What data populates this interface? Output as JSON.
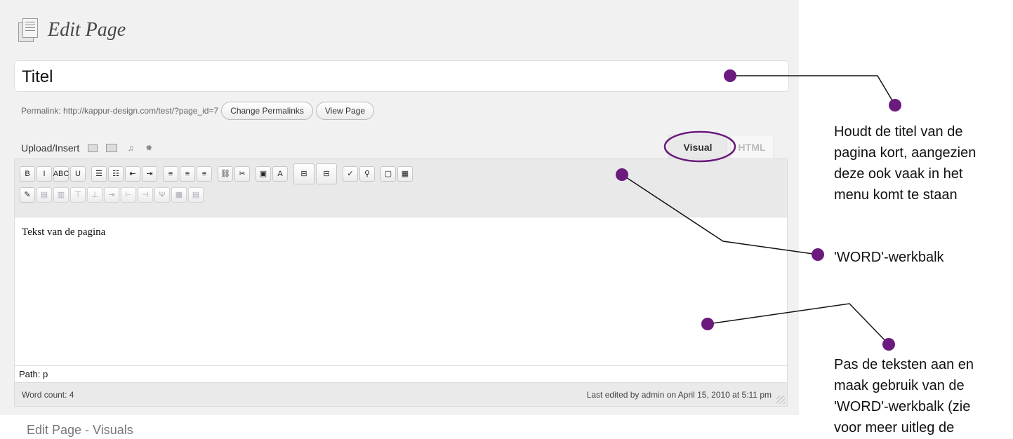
{
  "heading": {
    "title": "Edit Page",
    "icon": "page-icon"
  },
  "title_field": {
    "value": "Titel"
  },
  "permalink": {
    "label": "Permalink: http://kappur-design.com/test/?page_id=7",
    "change_button": "Change Permalinks",
    "view_button": "View Page"
  },
  "upload": {
    "label": "Upload/Insert",
    "icons": [
      "image-icon",
      "video-icon",
      "audio-icon",
      "media-icon"
    ]
  },
  "tabs": {
    "visual": "Visual",
    "html": "HTML"
  },
  "editor": {
    "content": "Tekst van de pagina",
    "path": "Path: p",
    "word_count": "Word count: 4",
    "last_edited": "Last edited by admin on April 15, 2010 at 5:11 pm"
  },
  "toolbar_row1": [
    {
      "name": "bold-button",
      "glyph": "B"
    },
    {
      "name": "italic-button",
      "glyph": "I"
    },
    {
      "name": "strikethrough-button",
      "glyph": "ABC"
    },
    {
      "name": "underline-button",
      "glyph": "U"
    },
    {
      "name": "bullet-list-button",
      "glyph": "☰"
    },
    {
      "name": "numbered-list-button",
      "glyph": "☷"
    },
    {
      "name": "outdent-button",
      "glyph": "⇤"
    },
    {
      "name": "indent-button",
      "glyph": "⇥"
    },
    {
      "name": "align-left-button",
      "glyph": "≡"
    },
    {
      "name": "align-center-button",
      "glyph": "≡"
    },
    {
      "name": "align-right-button",
      "glyph": "≡"
    },
    {
      "name": "link-button",
      "glyph": "⛓"
    },
    {
      "name": "unlink-button",
      "glyph": "✂"
    },
    {
      "name": "insert-image-button",
      "glyph": "▣"
    },
    {
      "name": "text-color-button",
      "glyph": "A"
    },
    {
      "name": "page-break-button",
      "glyph": "⊟"
    },
    {
      "name": "more-button",
      "glyph": "⊟"
    },
    {
      "name": "spellcheck-button",
      "glyph": "✓"
    },
    {
      "name": "find-button",
      "glyph": "⚲"
    },
    {
      "name": "fullscreen-button",
      "glyph": "▢"
    },
    {
      "name": "kitchen-sink-button",
      "glyph": "▦"
    }
  ],
  "toolbar_row2": [
    {
      "name": "edit-button",
      "glyph": "✎"
    },
    {
      "name": "table-button",
      "glyph": "▤"
    },
    {
      "name": "table-props-button",
      "glyph": "▥"
    },
    {
      "name": "row-before-button",
      "glyph": "⊤"
    },
    {
      "name": "row-after-button",
      "glyph": "⊥"
    },
    {
      "name": "delete-row-button",
      "glyph": "⇥"
    },
    {
      "name": "col-before-button",
      "glyph": "⊢"
    },
    {
      "name": "col-after-button",
      "glyph": "⊣"
    },
    {
      "name": "delete-col-button",
      "glyph": "Ψ"
    },
    {
      "name": "split-cells-button",
      "glyph": "▦"
    },
    {
      "name": "merge-cells-button",
      "glyph": "▤"
    }
  ],
  "annotations": {
    "note1": [
      "Houdt de titel van de",
      "pagina kort, aangezien",
      "deze ook vaak in het",
      "menu komt te staan"
    ],
    "note2": "'WORD'-werkbalk",
    "note3": [
      "Pas de teksten aan en",
      "maak gebruik van de",
      "'WORD'-werkbalk (zie",
      "voor meer uitleg de"
    ]
  },
  "caption": "Edit Page - Visuals",
  "colors": {
    "annotation": "#6a1b7d",
    "panel": "#f1f1f1",
    "toolbar": "#e9e9e9"
  }
}
